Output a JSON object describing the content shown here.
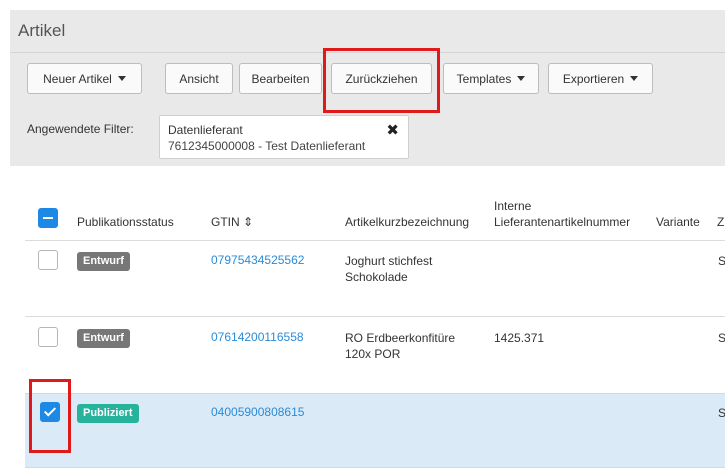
{
  "header": {
    "title": "Artikel"
  },
  "toolbar": {
    "new_article": "Neuer Artikel",
    "view": "Ansicht",
    "edit": "Bearbeiten",
    "withdraw": "Zurückziehen",
    "templates": "Templates",
    "export": "Exportieren"
  },
  "filters": {
    "label": "Angewendete Filter:",
    "chips": [
      {
        "name": "Datenlieferant",
        "value": "7612345000008 - Test Datenlieferant",
        "close_icon": "close-icon"
      }
    ]
  },
  "table": {
    "columns": {
      "status": "Publikationsstatus",
      "gtin": "GTIN",
      "gtin_sort": "⇕",
      "short_name": "Artikelkurzbezeichnung",
      "supplier_no_1": "Interne",
      "supplier_no_2": "Lieferantenartikelnummer",
      "variant": "Variante",
      "next": "Z"
    },
    "rows": [
      {
        "status": "Entwurf",
        "gtin": "07975434525562",
        "name_1": "Joghurt stichfest",
        "name_2": "Schokolade",
        "supplier_no": "",
        "variant": "",
        "next": "S",
        "selected": false
      },
      {
        "status": "Entwurf",
        "gtin": "07614200116558",
        "name_1": "RO Erdbeerkonfitüre",
        "name_2": "120x POR",
        "supplier_no": "1425.371",
        "variant": "",
        "next": "S",
        "selected": false
      },
      {
        "status": "Publiziert",
        "gtin": "04005900808615",
        "name_1": "",
        "name_2": "",
        "supplier_no": "",
        "variant": "",
        "next": "S",
        "selected": true
      }
    ]
  },
  "colors": {
    "accent": "#1e88e5",
    "draft_badge": "#777777",
    "published_badge": "#27b39b",
    "link": "#2a8bd8",
    "selected_row": "#daeaf7",
    "highlight": "#e0191b"
  }
}
